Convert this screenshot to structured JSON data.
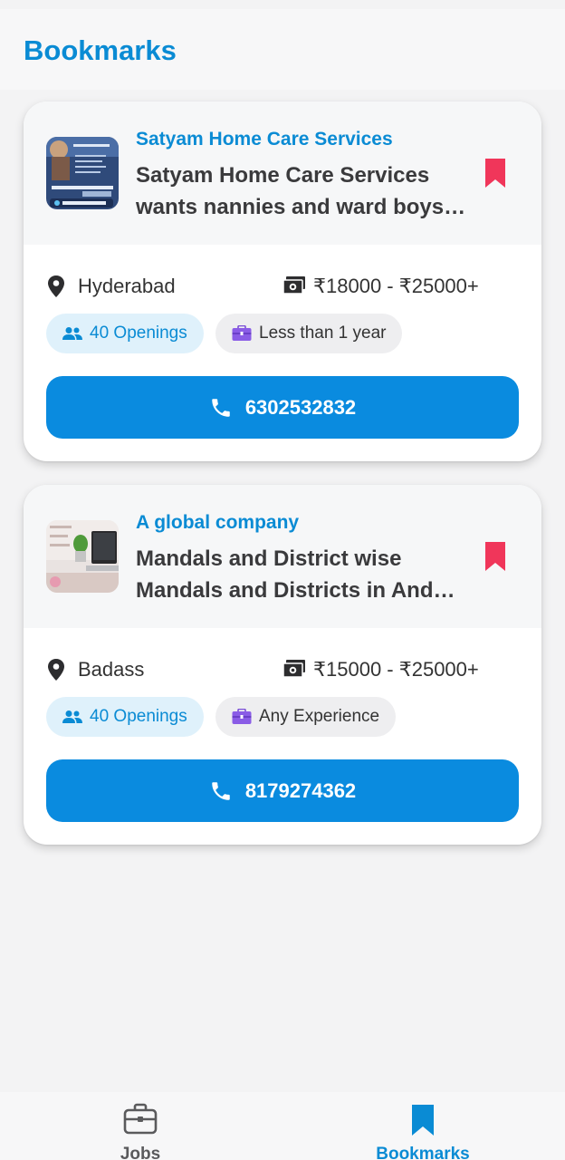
{
  "header": {
    "title": "Bookmarks"
  },
  "jobs": [
    {
      "company": "Satyam Home Care Services",
      "title": "Satyam Home Care Services wants nannies and ward boys…",
      "location": "Hyderabad",
      "salary": "₹18000 - ₹25000+",
      "openings": "40 Openings",
      "experience": "Less than 1 year",
      "phone": "6302532832",
      "bookmarked": true
    },
    {
      "company": "A global company",
      "title": "Mandals and District wise Mandals and Districts in And…",
      "location": "Badass",
      "salary": "₹15000 - ₹25000+",
      "openings": "40 Openings",
      "experience": "Any Experience",
      "phone": "8179274362",
      "bookmarked": true
    }
  ],
  "bottom_nav": {
    "jobs_label": "Jobs",
    "bookmarks_label": "Bookmarks",
    "active": "Bookmarks"
  },
  "colors": {
    "accent": "#0a8bd4",
    "button": "#0a8bdf",
    "bookmark": "#f0365a"
  }
}
